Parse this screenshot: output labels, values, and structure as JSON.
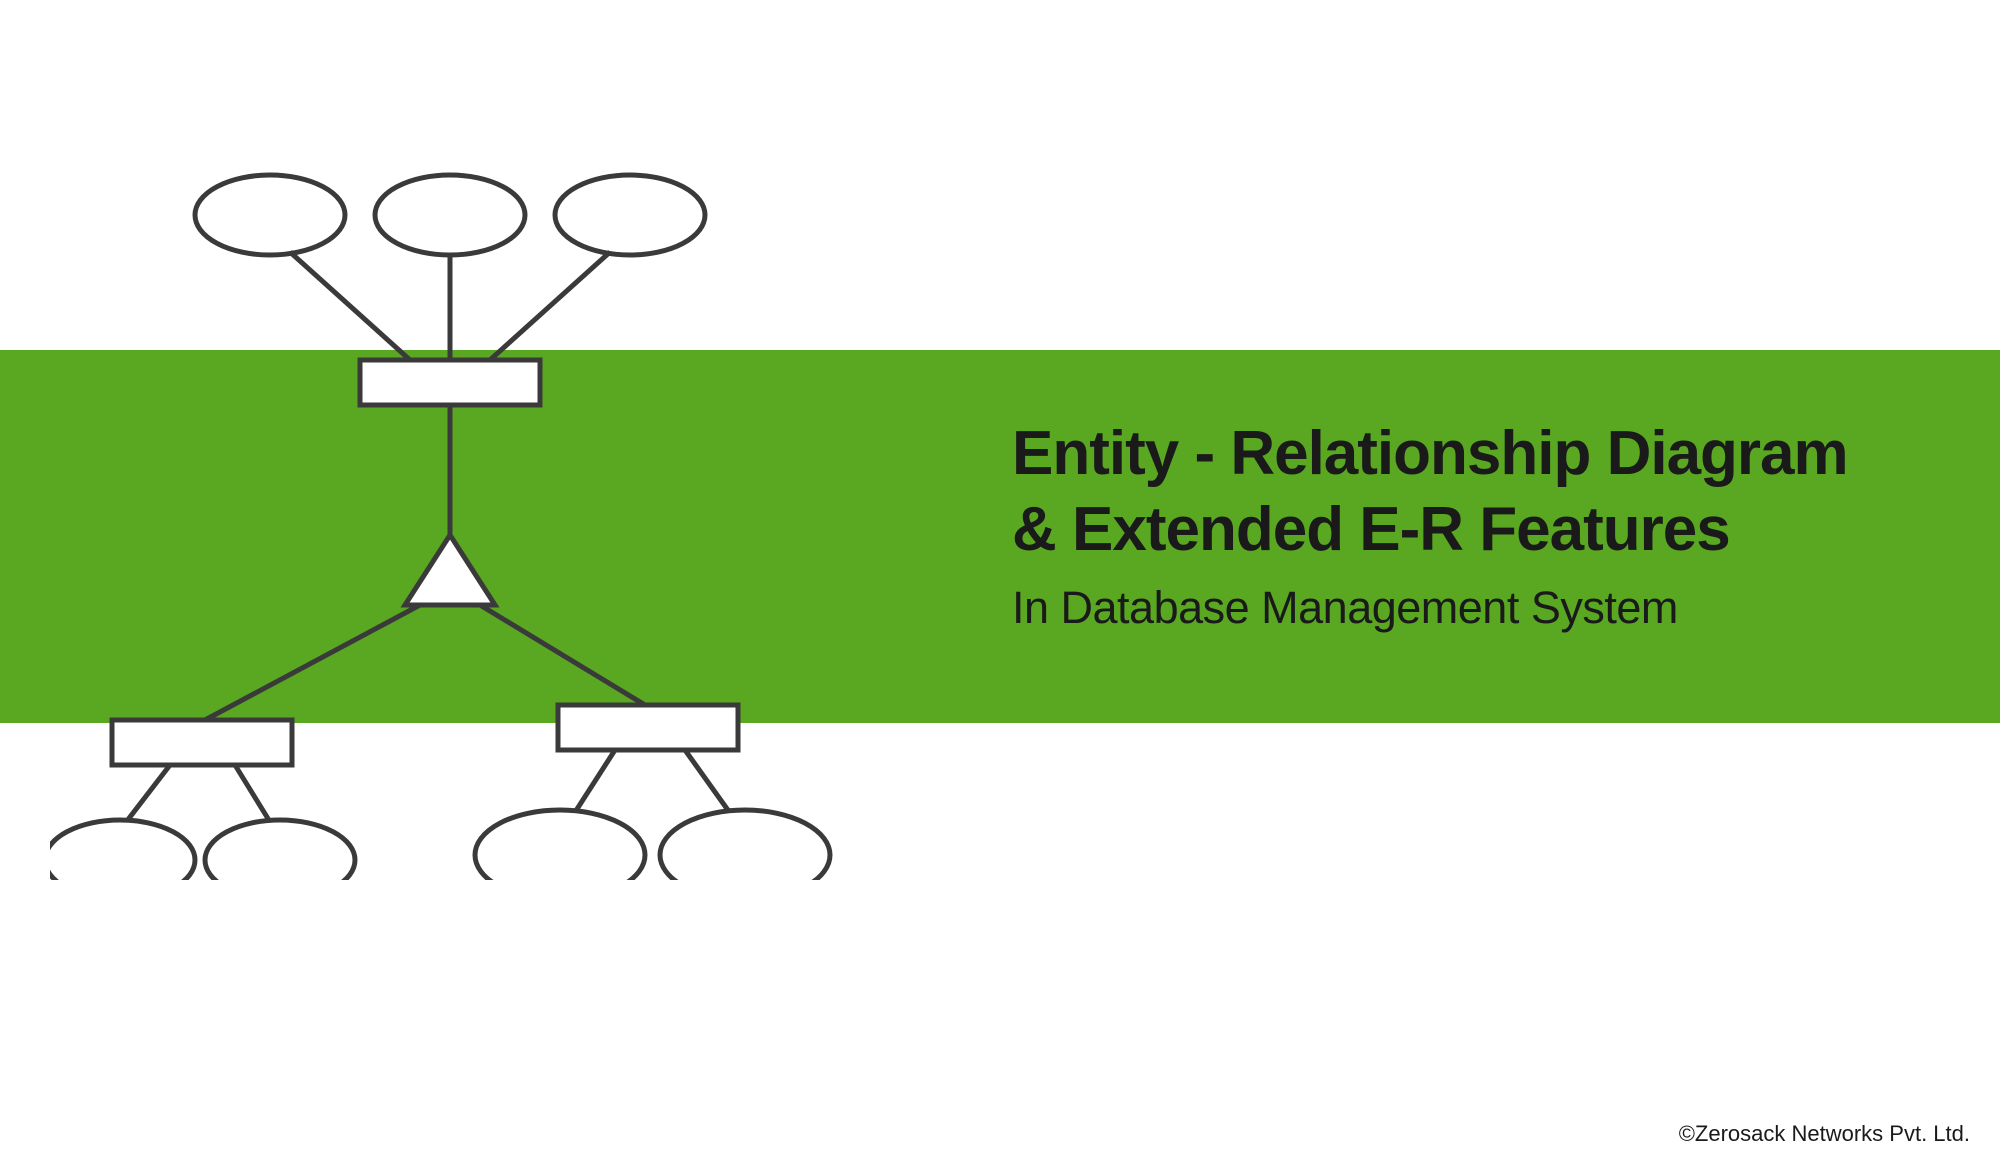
{
  "title_line1": "Entity - Relationship Diagram",
  "title_line2": "& Extended E-R Features",
  "subtitle": "In Database Management System",
  "copyright": "©Zerosack Networks Pvt. Ltd.",
  "colors": {
    "band": "#5aa822",
    "stroke": "#3a3a3a",
    "text": "#1a1a1a",
    "fill": "#ffffff"
  },
  "diagram": {
    "description": "ISA hierarchy: one parent entity (rectangle) with three attribute ellipses on top, connected via triangle (ISA) to two child entity rectangles, each with two attribute ellipses below.",
    "shapes": {
      "top_ellipses": 3,
      "parent_rect": 1,
      "isa_triangle": 1,
      "child_rects": 2,
      "bottom_left_ellipses": 2,
      "bottom_right_ellipses": 2
    }
  }
}
